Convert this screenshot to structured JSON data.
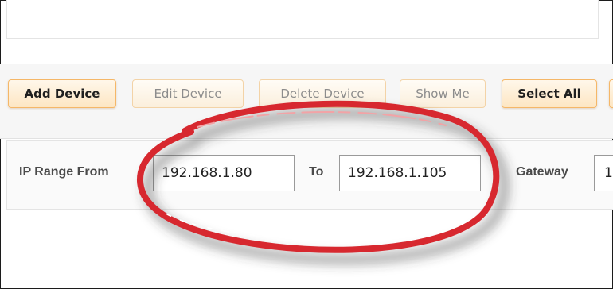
{
  "toolbar": {
    "add_device": "Add Device",
    "edit_device": "Edit Device",
    "delete_device": "Delete Device",
    "show_me": "Show Me",
    "select_all": "Select All"
  },
  "ip_range": {
    "from_label": "IP Range From",
    "from_value": "192.168.1.80",
    "to_label": "To",
    "to_value": "192.168.1.105",
    "gateway_label": "Gateway",
    "gateway_value": "1"
  },
  "colors": {
    "button_fill": "#fde6c3",
    "button_border": "#f5b768",
    "annotation_red": "#d7282f"
  }
}
